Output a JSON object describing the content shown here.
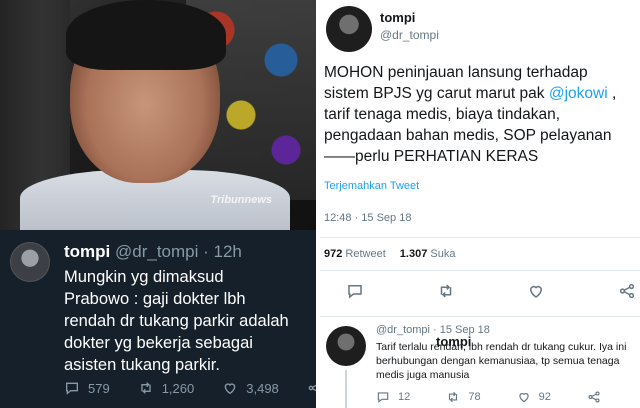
{
  "photo": {
    "watermark": "Tribunnews"
  },
  "dark_tweet": {
    "name": "tompi",
    "meta": " @dr_tompi · 12h",
    "text": "Mungkin yg dimaksud\nPrabowo : gaji dokter lbh\nrendah dr tukang parkir adalah\ndokter yg bekerja sebagai\nasisten tukang parkir.",
    "reply_count": "579",
    "retweet_count": "1,260",
    "like_count": "3,498",
    "icons": [
      "reply-icon",
      "retweet-icon",
      "like-icon",
      "share-icon"
    ]
  },
  "main_tweet": {
    "name": "tompi",
    "handle": "@dr_tompi",
    "text_before_mention": "MOHON peninjauan lansung terhadap sistem BPJS yg carut marut  pak ",
    "mention": "@jokowi",
    "text_after_mention": " , tarif tenaga medis, biaya tindakan, pengadaan bahan medis, SOP pelayanan ——perlu PERHATIAN KERAS",
    "translate_label": "Terjemahkan Tweet",
    "time": "12:48 · 15 Sep 18",
    "retweets": "972",
    "retweets_label": "Retweet",
    "likes": "1.307",
    "likes_label": "Suka"
  },
  "reply_tweet": {
    "name": "tompi",
    "meta": " @dr_tompi · 15 Sep 18",
    "text": "Tarif terlalu rendah, lbh rendah dr tukang cukur. Iya ini berhubungan dengan kemanusiaa, tp semua tenaga medis juga manusia",
    "reply_count": "12",
    "retweet_count": "78",
    "like_count": "92"
  },
  "colors": {
    "twitter_blue": "#1da1f2",
    "dark_bg": "#15202b",
    "muted": "#657786"
  }
}
